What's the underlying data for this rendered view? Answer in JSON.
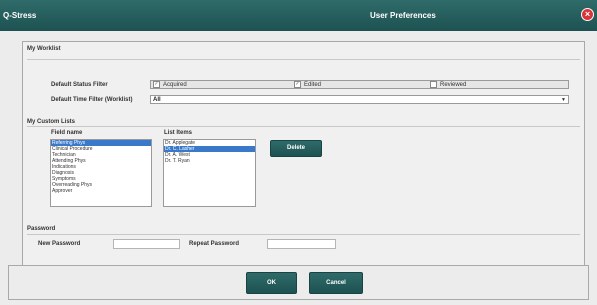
{
  "window": {
    "app_name": "Q-Stress",
    "title": "User Preferences",
    "close_glyph": "×"
  },
  "worklist": {
    "section_title": "My Worklist",
    "status_filter_label": "Default Status Filter",
    "status_options": [
      {
        "label": "Acquired",
        "checked": true
      },
      {
        "label": "Edited",
        "checked": true
      },
      {
        "label": "Reviewed",
        "checked": false
      }
    ],
    "time_filter_label": "Default Time Filter (Worklist)",
    "time_filter_value": "All"
  },
  "custom_lists": {
    "section_title": "My Custom Lists",
    "field_name_label": "Field name",
    "list_items_label": "List Items",
    "field_names": [
      "Referring Phys",
      "Clinical Procedure",
      "Technician",
      "Attending Phys",
      "Indications",
      "Diagnosis",
      "Symptoms",
      "Overreading Phys",
      "Approver"
    ],
    "selected_field_index": 0,
    "list_items": [
      "Dr. Applegate",
      "Dr. C. Lasher",
      "Dr. A. West",
      "Dr. T. Ryan"
    ],
    "selected_item_index": 1,
    "delete_label": "Delete"
  },
  "password": {
    "section_title": "Password",
    "new_label": "New Password",
    "repeat_label": "Repeat Password",
    "new_value": "",
    "repeat_value": ""
  },
  "footer": {
    "ok_label": "OK",
    "cancel_label": "Cancel"
  },
  "colors": {
    "titlebar": "#1d5251",
    "selection": "#3a78c9",
    "close": "#d9343a"
  }
}
